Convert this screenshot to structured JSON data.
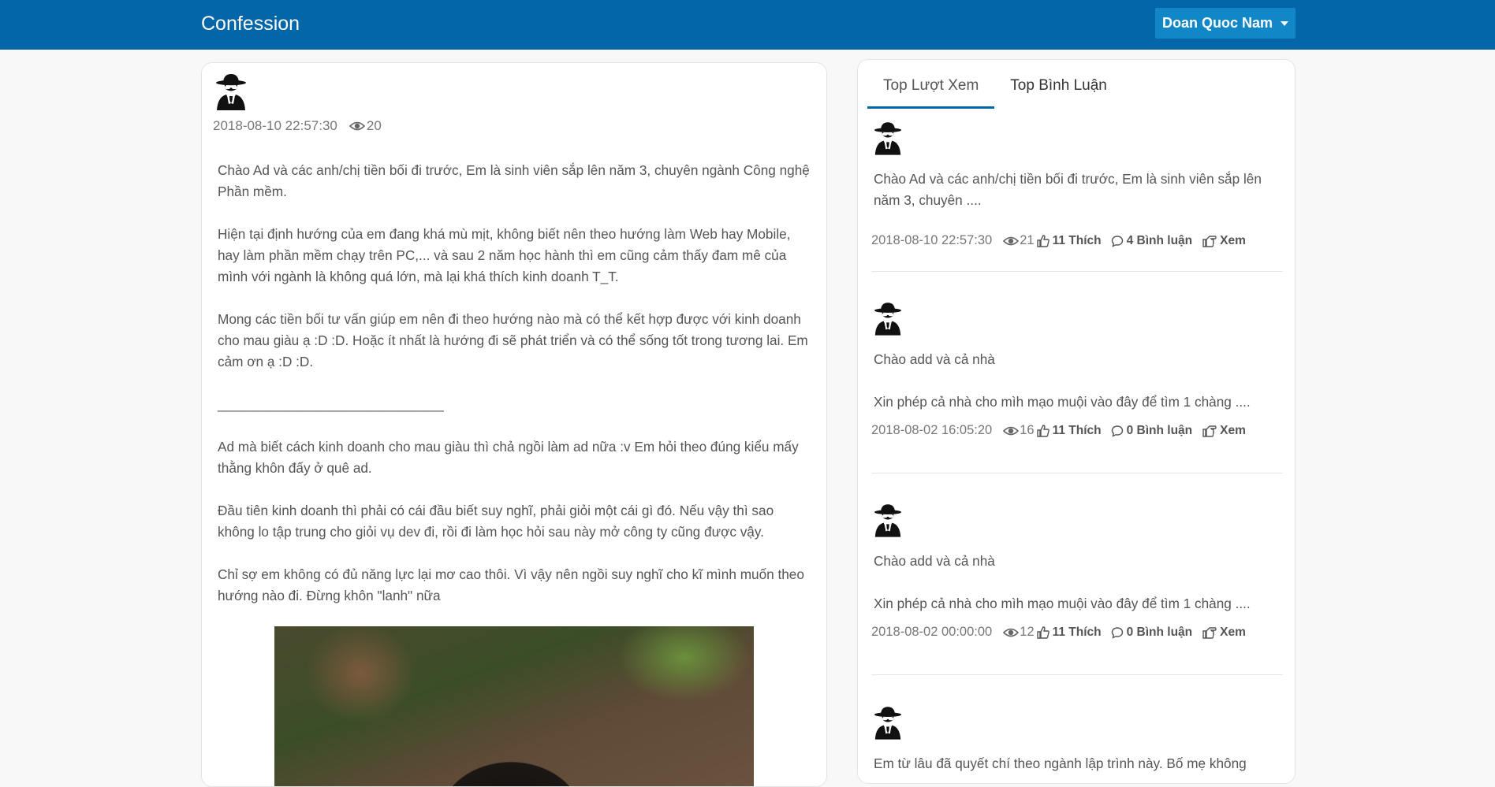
{
  "navbar": {
    "brand": "Confession",
    "user_name": "Doan Quoc Nam"
  },
  "post": {
    "timestamp": "2018-08-10 22:57:30",
    "views": "20",
    "paragraphs": [
      "Chào Ad và các anh/chị tiền bối đi trước, Em là sinh viên sắp lên năm 3, chuyên ngành Công nghệ Phần mềm.",
      "Hiện tại định hướng của em đang khá mù mịt, không biết nên theo hướng làm Web hay Mobile, hay làm phần mềm chạy trên PC,... và sau 2 năm học hành thì em cũng cảm thấy đam mê của mình với ngành là không quá lớn, mà lại khá thích kinh doanh T_T.",
      "Mong các tiền bối tư vấn giúp em nên đi theo hướng nào mà có thể kết hợp được với kinh doanh cho mau giàu ạ :D :D. Hoặc ít nhất là hướng đi sẽ phát triển và có thể sống tốt trong tương lai. Em cảm ơn ạ :D :D.",
      "______________________________",
      "Ad mà biết cách kinh doanh cho mau giàu thì chả ngồi làm ad nữa :v Em hỏi theo đúng kiểu mấy thằng khôn đấy ở quê ad.",
      "Đầu tiên kinh doanh thì phải có cái đầu biết suy nghĩ, phải giỏi một cái gì đó. Nếu vậy thì sao không lo tập trung cho giỏi vụ dev đi, rồi đi làm học hỏi sau này mở công ty cũng được vậy.",
      "Chỉ sợ em không có đủ năng lực lại mơ cao thôi. Vì vậy nên ngồi suy nghĩ cho kĩ mình muốn theo hướng nào đi. Đừng khôn \"lanh\" nữa"
    ]
  },
  "sidebar": {
    "tabs": [
      "Top Lượt Xem",
      "Top Bình Luận"
    ],
    "items": [
      {
        "lines": [
          "Chào Ad và các anh/chị tiền bối đi trước, Em là sinh viên sắp lên năm 3, chuyên ...."
        ],
        "timestamp": "2018-08-10 22:57:30",
        "views": "21",
        "likes": "11 Thích",
        "comments": "4 Bình luận",
        "view_label": "Xem"
      },
      {
        "lines": [
          "Chào add và cả nhà",
          "Xin phép cả nhà cho mìh mạo muội vào đây để tìm 1 chàng ...."
        ],
        "timestamp": "2018-08-02 16:05:20",
        "views": "16",
        "likes": "11 Thích",
        "comments": "0 Bình luận",
        "view_label": "Xem"
      },
      {
        "lines": [
          "Chào add và cả nhà",
          "Xin phép cả nhà cho mìh mạo muội vào đây để tìm 1 chàng ...."
        ],
        "timestamp": "2018-08-02 00:00:00",
        "views": "12",
        "likes": "11 Thích",
        "comments": "0 Bình luận",
        "view_label": "Xem"
      },
      {
        "lines": [
          "Em từ lâu đã quyết chí theo ngành lập trình này. Bố mẹ không"
        ]
      }
    ]
  }
}
